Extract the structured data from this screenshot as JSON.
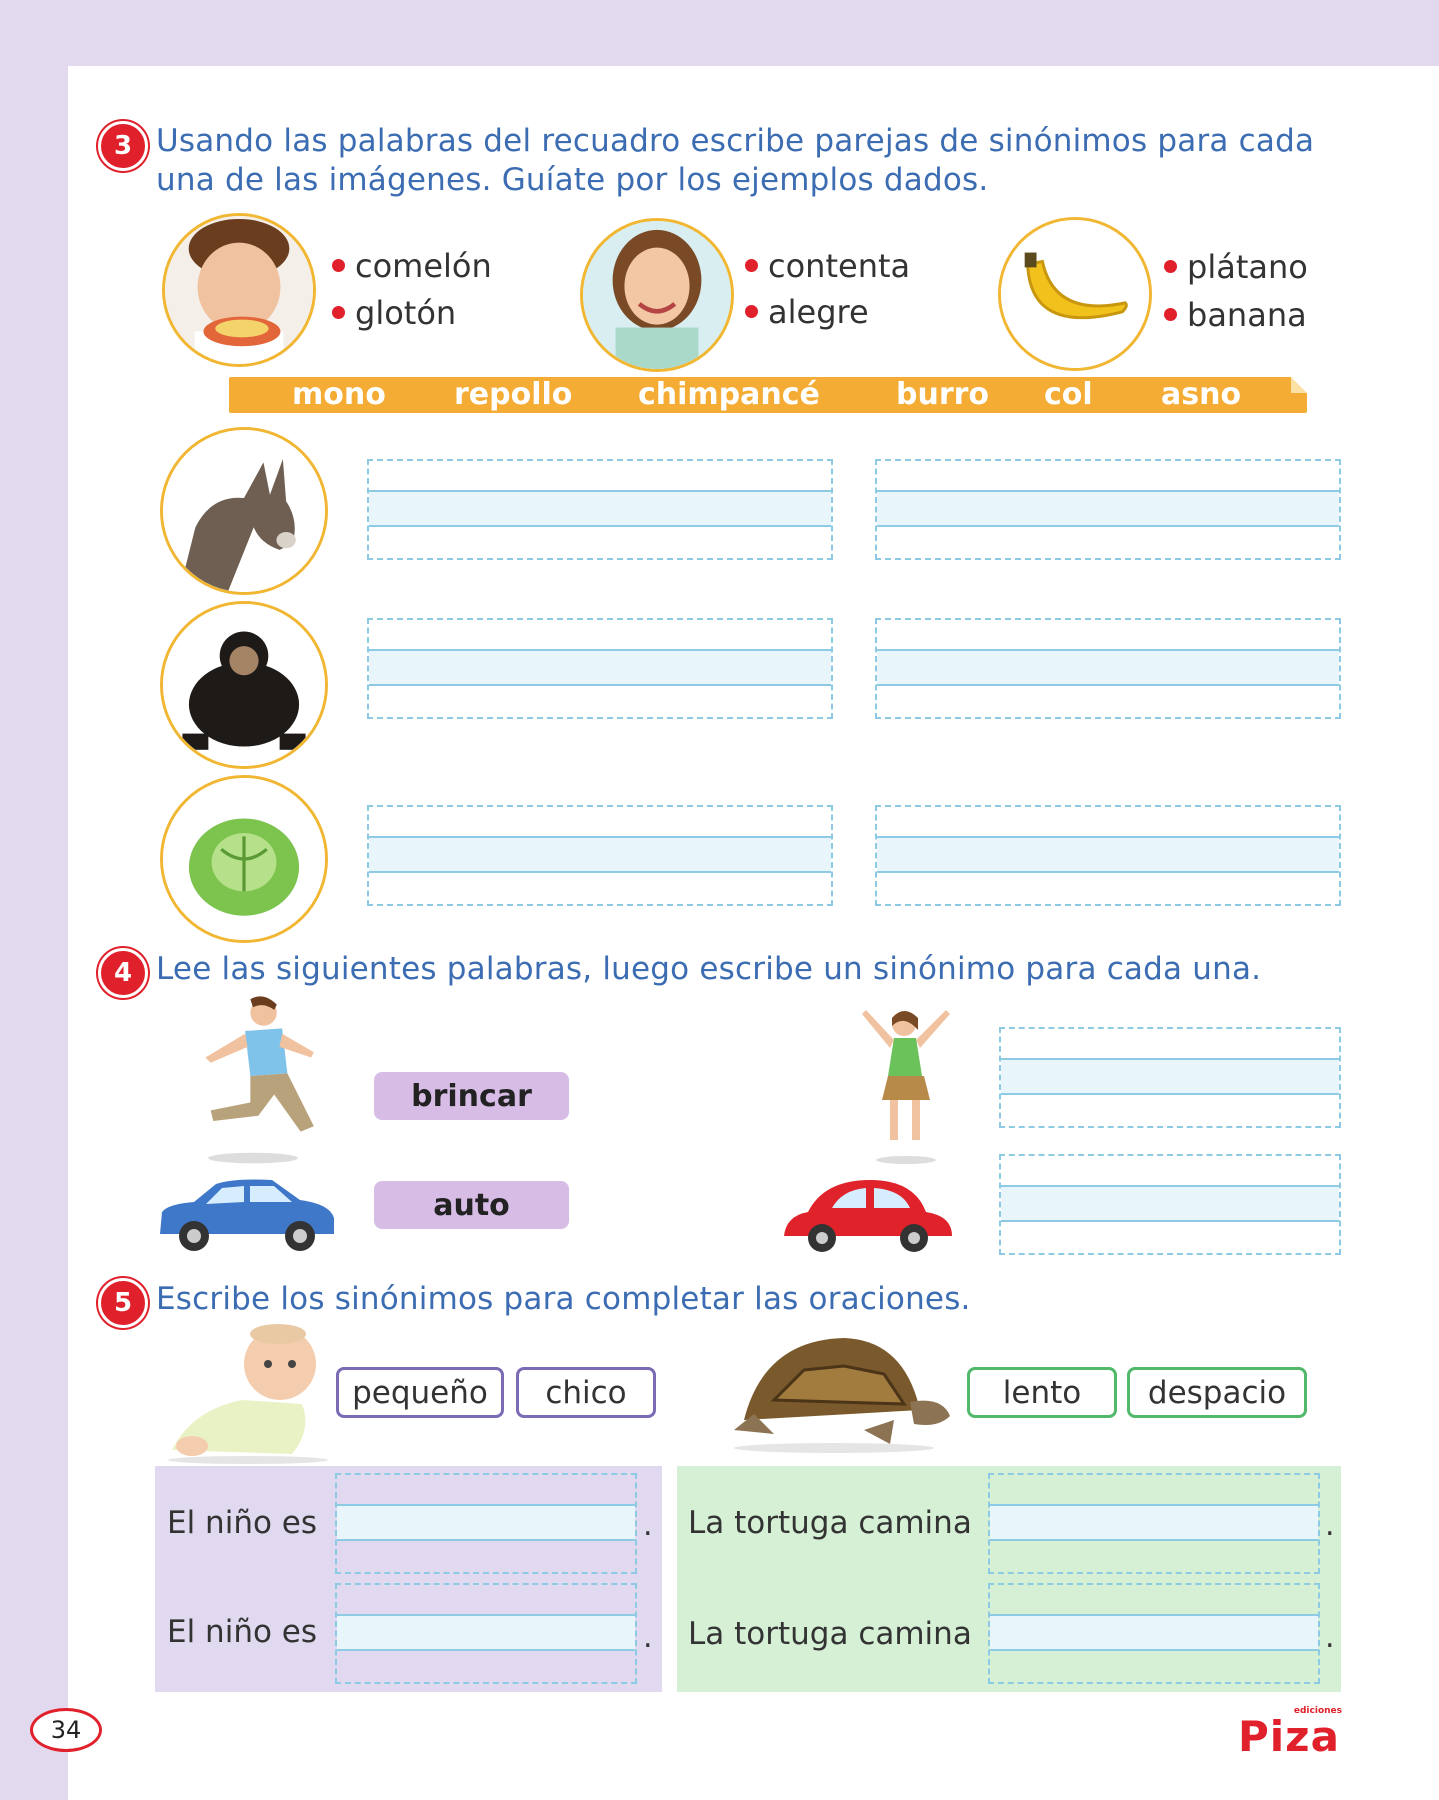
{
  "ex3": {
    "number": "3",
    "instruction_line1": "Usando las palabras del recuadro escribe parejas de sinónimos para cada",
    "instruction_line2": "una de las imágenes. Guíate por los ejemplos dados.",
    "examples": [
      {
        "word1": "comelón",
        "word2": "glotón"
      },
      {
        "word1": "contenta",
        "word2": "alegre"
      },
      {
        "word1": "plátano",
        "word2": "banana"
      }
    ],
    "word_bank": [
      "mono",
      "repollo",
      "chimpancé",
      "burro",
      "col",
      "asno"
    ]
  },
  "ex4": {
    "number": "4",
    "instruction": "Lee las siguientes palabras, luego escribe un sinónimo para cada una.",
    "words": [
      "brincar",
      "auto"
    ]
  },
  "ex5": {
    "number": "5",
    "instruction": "Escribe los sinónimos para completar las oraciones.",
    "options_left": [
      "pequeño",
      "chico"
    ],
    "options_right": [
      "lento",
      "despacio"
    ],
    "sentence_left": "El niño es",
    "sentence_right": "La tortuga camina",
    "period": "."
  },
  "footer": {
    "page_number": "34",
    "logo_small": "ediciones",
    "logo": "Piza"
  },
  "colors": {
    "accent_red": "#e0202b",
    "title_blue": "#3c6db2",
    "wordbar_orange": "#f5ac34",
    "page_bg": "#e3d9ef"
  }
}
